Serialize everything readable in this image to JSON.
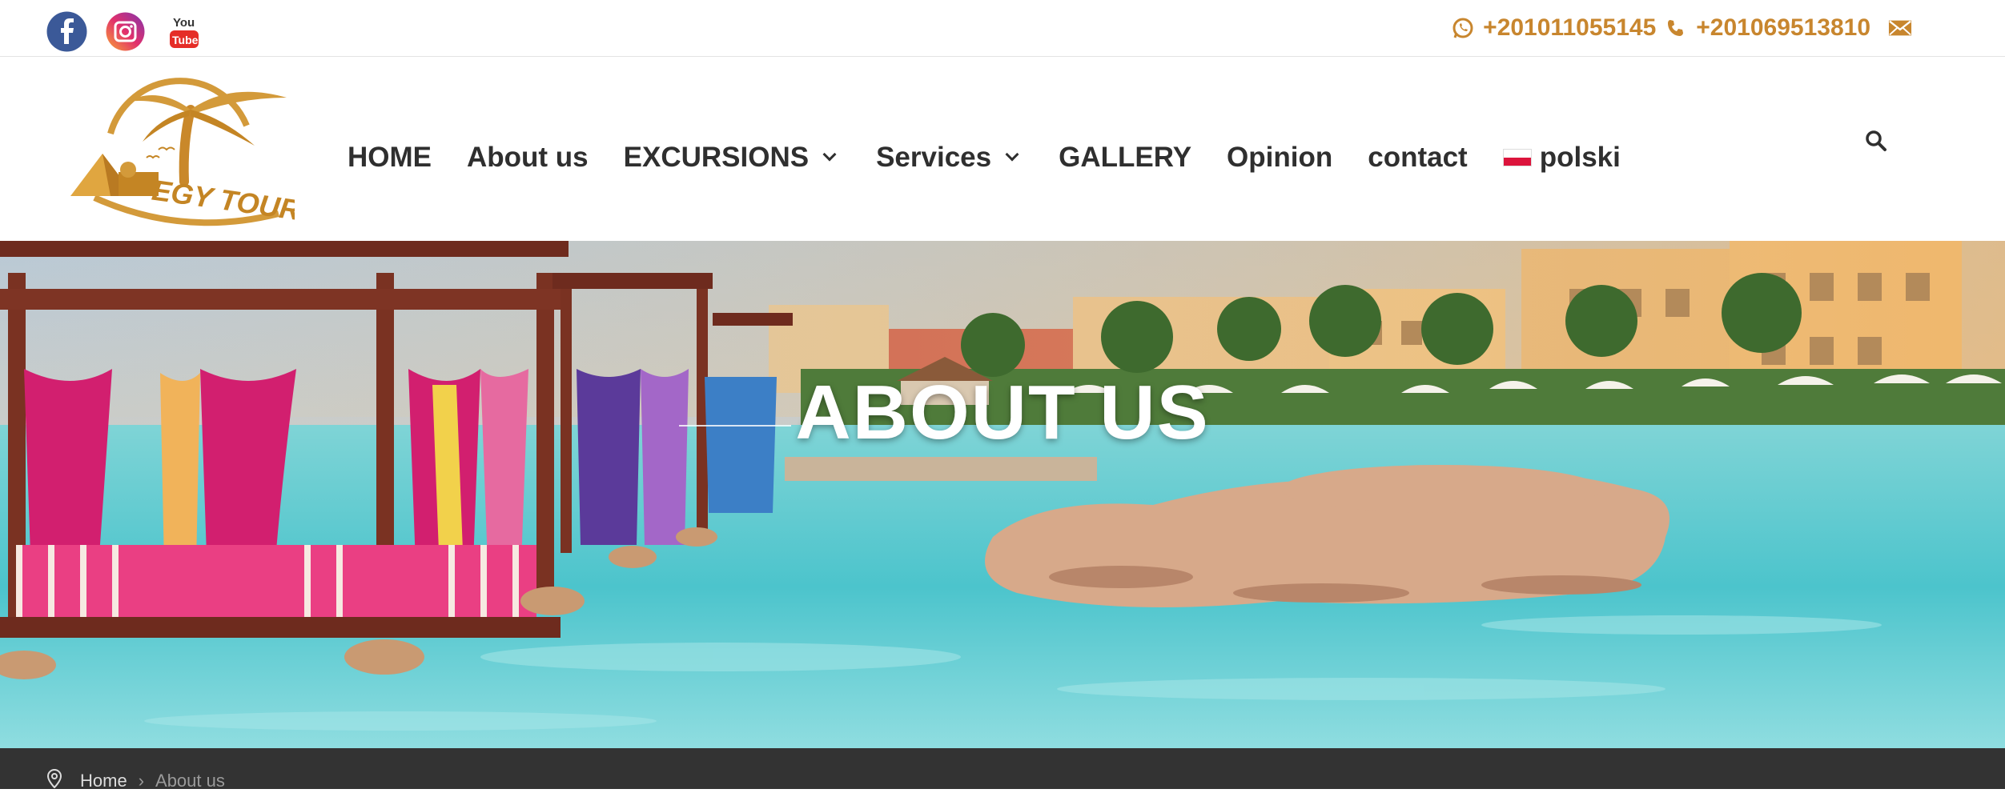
{
  "topbar": {
    "social": [
      {
        "icon": "facebook-icon"
      },
      {
        "icon": "instagram-icon"
      },
      {
        "icon": "youtube-icon",
        "label": "You Tube"
      }
    ],
    "phone1": "+201011055145",
    "phone2": "+201069513810"
  },
  "logo": {
    "text": "EGY TOURS"
  },
  "nav": {
    "home": "HOME",
    "about": "About us",
    "excursions": "EXCURSIONS",
    "services": "Services",
    "gallery": "GALLERY",
    "opinion": "Opinion",
    "contact": "contact",
    "language": "polski"
  },
  "hero": {
    "title": "ABOUT US"
  },
  "breadcrumb": {
    "home": "Home",
    "current": "About us"
  },
  "colors": {
    "accent": "#c8862e",
    "dark": "#333333",
    "pink": "#d21f6f",
    "water": "#4fc9d3"
  }
}
